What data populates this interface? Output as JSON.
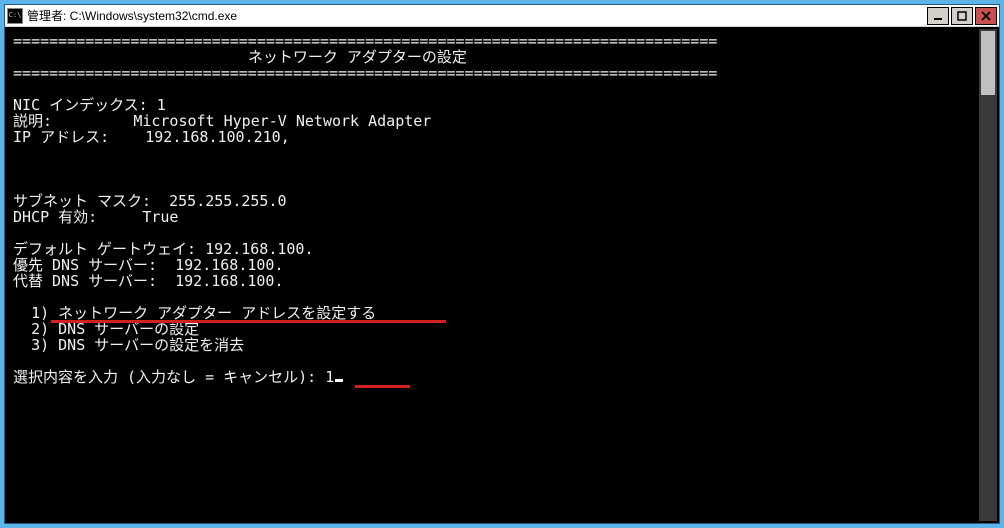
{
  "titlebar": {
    "icon_label": "C:\\",
    "title": "管理者: C:\\Windows\\system32\\cmd.exe"
  },
  "console": {
    "rule": "==============================================================================",
    "header_title": "ネットワーク アダプターの設定",
    "nic_index_label": "NIC インデックス:",
    "nic_index_value": "1",
    "desc_label": "説明:",
    "desc_value": "Microsoft Hyper-V Network Adapter",
    "ip_label": "IP アドレス:",
    "ip_value": "192.168.100.210,",
    "subnet_label": "サブネット マスク:",
    "subnet_value": "255.255.255.0",
    "dhcp_label": "DHCP 有効:",
    "dhcp_value": "True",
    "gateway_label": "デフォルト ゲートウェイ:",
    "gateway_value": "192.168.100.",
    "dns1_label": "優先 DNS サーバー:",
    "dns1_value": "192.168.100.",
    "dns2_label": "代替 DNS サーバー:",
    "dns2_value": "192.168.100.",
    "option1": "1) ネットワーク アダプター アドレスを設定する",
    "option2": "2) DNS サーバーの設定",
    "option3": "3) DNS サーバーの設定を消去",
    "prompt": "選択内容を入力 (入力なし = キャンセル):",
    "input_value": "1"
  }
}
